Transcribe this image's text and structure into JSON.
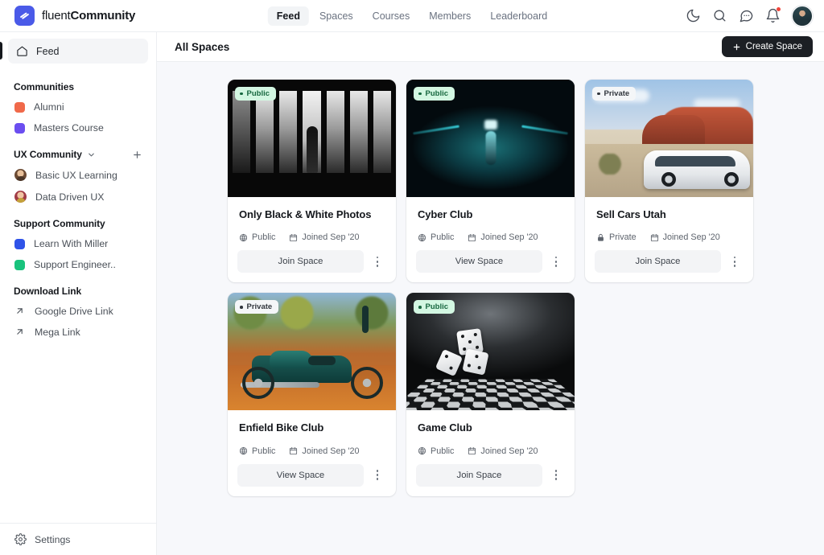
{
  "brand": {
    "name_light": "fluent",
    "name_bold": "Community"
  },
  "nav": {
    "items": [
      {
        "label": "Feed",
        "active": true
      },
      {
        "label": "Spaces",
        "active": false
      },
      {
        "label": "Courses",
        "active": false
      },
      {
        "label": "Members",
        "active": false
      },
      {
        "label": "Leaderboard",
        "active": false
      }
    ]
  },
  "top_actions": {
    "dark_mode": "moon-icon",
    "search": "search-icon",
    "messages": "chat-icon",
    "notifications": "bell-icon",
    "has_notification": true,
    "avatar": "user-avatar"
  },
  "sidebar": {
    "feed": {
      "label": "Feed",
      "icon": "home-icon",
      "active": true
    },
    "sections": [
      {
        "title": "Communities",
        "has_chevron": false,
        "has_plus": false,
        "items": [
          {
            "label": "Alumni",
            "marker": "square",
            "color": "#f0694a"
          },
          {
            "label": "Masters Course",
            "marker": "square",
            "color": "#6b4ef0"
          }
        ]
      },
      {
        "title": "UX Community",
        "has_chevron": true,
        "has_plus": true,
        "items": [
          {
            "label": "Basic UX Learning",
            "marker": "avatar",
            "avatar_class": "a1"
          },
          {
            "label": "Data Driven UX",
            "marker": "avatar",
            "avatar_class": "a2"
          }
        ]
      },
      {
        "title": "Support Community",
        "has_chevron": false,
        "has_plus": false,
        "items": [
          {
            "label": "Learn With Miller",
            "marker": "square",
            "color": "#2f53e8"
          },
          {
            "label": "Support Engineer..",
            "marker": "square",
            "color": "#19c37d"
          }
        ]
      },
      {
        "title": "Download Link",
        "has_chevron": false,
        "has_plus": false,
        "items": [
          {
            "label": "Google Drive Link",
            "marker": "arrow"
          },
          {
            "label": "Mega Link",
            "marker": "arrow"
          }
        ]
      }
    ],
    "settings": {
      "label": "Settings",
      "icon": "gear-icon"
    }
  },
  "main": {
    "title": "All Spaces",
    "create_button": {
      "label": "Create Space",
      "icon": "plus-icon"
    },
    "cards": [
      {
        "badge": "Public",
        "badge_type": "public",
        "title": "Only Black & White Photos",
        "privacy": "Public",
        "privacy_icon": "globe-icon",
        "joined": "Joined Sep '20",
        "joined_icon": "calendar-icon",
        "action": "Join Space",
        "art": "art-bw"
      },
      {
        "badge": "Public",
        "badge_type": "public",
        "title": "Cyber Club",
        "privacy": "Public",
        "privacy_icon": "globe-icon",
        "joined": "Joined Sep '20",
        "joined_icon": "calendar-icon",
        "action": "View Space",
        "art": "art-cyber"
      },
      {
        "badge": "Private",
        "badge_type": "private",
        "title": "Sell Cars Utah",
        "privacy": "Private",
        "privacy_icon": "lock-icon",
        "joined": "Joined Sep '20",
        "joined_icon": "calendar-icon",
        "action": "Join Space",
        "art": "art-utah"
      },
      {
        "badge": "Private",
        "badge_type": "private",
        "title": "Enfield Bike Club",
        "privacy": "Public",
        "privacy_icon": "globe-icon",
        "joined": "Joined Sep '20",
        "joined_icon": "calendar-icon",
        "action": "View Space",
        "art": "art-bike"
      },
      {
        "badge": "Public",
        "badge_type": "public",
        "title": "Game Club",
        "privacy": "Public",
        "privacy_icon": "globe-icon",
        "joined": "Joined Sep '20",
        "joined_icon": "calendar-icon",
        "action": "Join Space",
        "art": "art-game"
      }
    ]
  },
  "colors": {
    "brand": "#4a5ae8",
    "public_badge_bg": "#d3f7e2",
    "public_badge_text": "#17673f",
    "private_badge_bg": "#f4f6f8",
    "notification_dot": "#f0453a",
    "page_bg": "#f7f8fb"
  }
}
